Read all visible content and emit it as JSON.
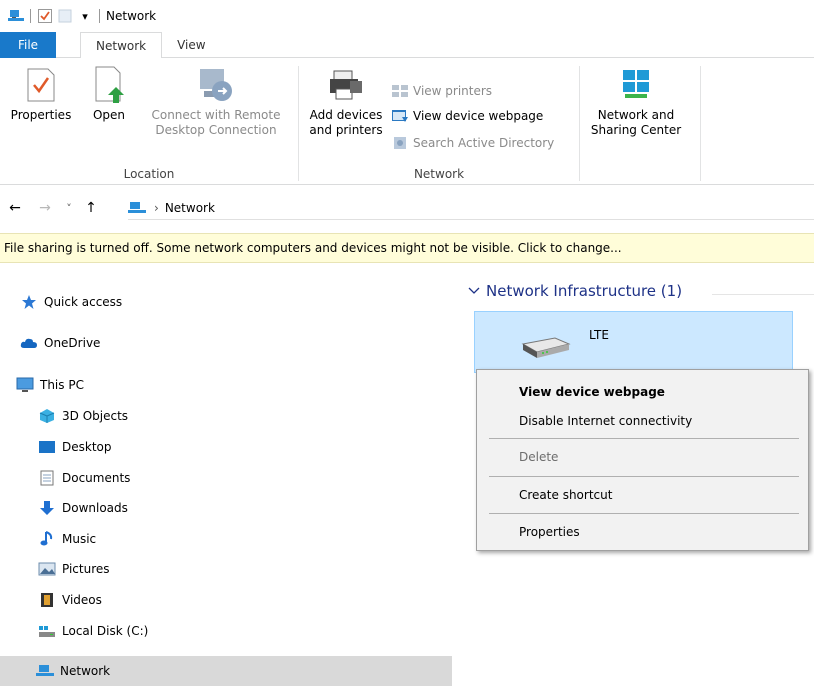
{
  "window": {
    "title": "Network",
    "qat_dropdown": "▾"
  },
  "ribbon_tabs": {
    "file": "File",
    "network": "Network",
    "view": "View"
  },
  "ribbon": {
    "location_group": {
      "label": "Location",
      "properties": "Properties",
      "open": "Open",
      "connect_remote_line1": "Connect with Remote",
      "connect_remote_line2": "Desktop Connection"
    },
    "network_group": {
      "label": "Network",
      "add_devices_line1": "Add devices",
      "add_devices_line2": "and printers",
      "view_printers": "View printers",
      "view_device_webpage": "View device webpage",
      "search_active_directory": "Search Active Directory"
    },
    "sharing_group": {
      "network_sharing_line1": "Network and",
      "network_sharing_line2": "Sharing Center"
    }
  },
  "address": {
    "back": "←",
    "forward": "→",
    "recent": "˅",
    "up": "↑",
    "separator": "›",
    "location": "Network"
  },
  "infobar": {
    "text": "File sharing is turned off. Some network computers and devices might not be visible. Click to change..."
  },
  "navpane": {
    "items": [
      {
        "label": "Quick access"
      },
      {
        "label": "OneDrive"
      },
      {
        "label": "This PC"
      },
      {
        "label": "3D Objects"
      },
      {
        "label": "Desktop"
      },
      {
        "label": "Documents"
      },
      {
        "label": "Downloads"
      },
      {
        "label": "Music"
      },
      {
        "label": "Pictures"
      },
      {
        "label": "Videos"
      },
      {
        "label": "Local Disk (C:)"
      },
      {
        "label": "Network"
      }
    ]
  },
  "content": {
    "group_header": "Network Infrastructure (1)",
    "device": {
      "name": "LTE"
    }
  },
  "context_menu": {
    "items": [
      {
        "label": "View device webpage"
      },
      {
        "label": "Disable Internet connectivity"
      },
      {
        "label": "Delete"
      },
      {
        "label": "Create shortcut"
      },
      {
        "label": "Properties"
      }
    ]
  },
  "colors": {
    "file_tab": "#1979ca",
    "selection": "#cce8ff",
    "infobar": "#fffdd9",
    "group_header": "#1e3287"
  }
}
